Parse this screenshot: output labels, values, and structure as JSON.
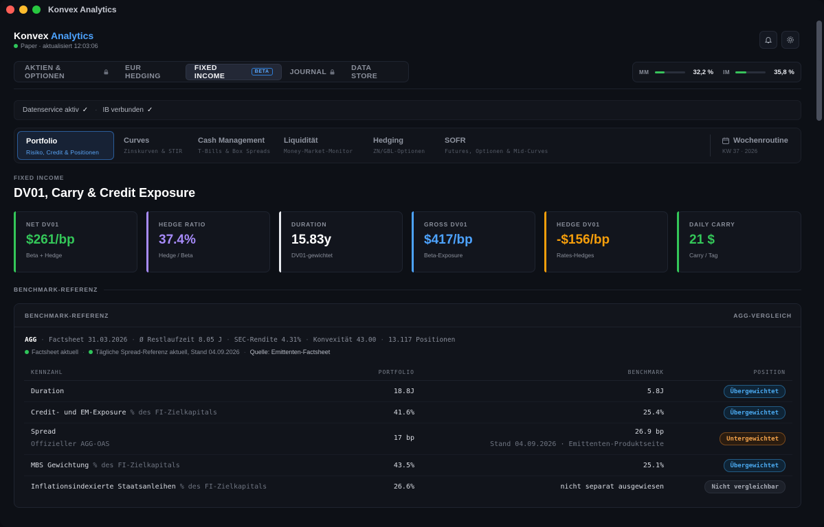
{
  "window": {
    "title": "Konvex Analytics"
  },
  "brand": {
    "name": "Konvex",
    "accent": "Analytics",
    "status_mode": "Paper",
    "status_updated": "· aktualisiert 12:03:06"
  },
  "main_tabs": [
    {
      "label": "AKTIEN & OPTIONEN",
      "locked": true
    },
    {
      "label": "EUR HEDGING",
      "locked": false
    },
    {
      "label": "FIXED INCOME",
      "badge": "BETA",
      "active": true
    },
    {
      "label": "JOURNAL",
      "locked": true
    },
    {
      "label": "DATA STORE",
      "locked": false
    }
  ],
  "meters": [
    {
      "label": "MM",
      "value": "32,2 %",
      "fraction": 0.322
    },
    {
      "label": "IM",
      "value": "35,8 %",
      "fraction": 0.358
    }
  ],
  "status": [
    {
      "label": "Datenservice aktiv"
    },
    {
      "label": "IB verbunden"
    }
  ],
  "sub_nav": [
    {
      "title": "Portfolio",
      "subtitle": "Risiko, Credit & Positionen",
      "active": true
    },
    {
      "title": "Curves",
      "subtitle": "Zinskurven & STIR"
    },
    {
      "title": "Cash Management",
      "subtitle": "T-Bills & Box Spreads"
    },
    {
      "title": "Liquidität",
      "subtitle": "Money-Market-Monitor"
    },
    {
      "title": "Hedging",
      "subtitle": "ZN/GBL-Optionen"
    },
    {
      "title": "SOFR",
      "subtitle": "Futures, Optionen & Mid-Curves"
    }
  ],
  "weekly": {
    "title": "Wochenroutine",
    "subtitle": "KW 37 · 2026"
  },
  "page": {
    "eyebrow": "FIXED INCOME",
    "title": "DV01, Carry & Credit Exposure"
  },
  "kpis": [
    {
      "label": "NET DV01",
      "value": "$261/bp",
      "sub": "Beta + Hedge",
      "color": "#34c759"
    },
    {
      "label": "HEDGE RATIO",
      "value": "37.4%",
      "sub": "Hedge / Beta",
      "color": "#a78bfa"
    },
    {
      "label": "DURATION",
      "value": "15.83y",
      "sub": "DV01-gewichtet",
      "color": "#ffffff"
    },
    {
      "label": "GROSS DV01",
      "value": "$417/bp",
      "sub": "Beta-Exposure",
      "color": "#4da3ff"
    },
    {
      "label": "HEDGE DV01",
      "value": "-$156/bp",
      "sub": "Rates-Hedges",
      "color": "#f59e0b"
    },
    {
      "label": "DAILY CARRY",
      "value": "21 $",
      "sub": "Carry / Tag",
      "color": "#34c759"
    }
  ],
  "benchmark": {
    "section_label": "BENCHMARK-REFERENZ",
    "panel_title": "BENCHMARK-REFERENZ",
    "panel_right": "AGG-VERGLEICH",
    "ticker": "AGG",
    "facts": [
      "Factsheet 31.03.2026",
      "Ø Restlaufzeit 8.05 J",
      "SEC-Rendite 4.31%",
      "Konvexität 43.00",
      "13.117 Positionen"
    ],
    "status_1": "Factsheet aktuell",
    "status_2": "Tägliche Spread-Referenz aktuell, Stand 04.09.2026",
    "source": "Quelle: Emittenten-Factsheet",
    "columns": [
      "KENNZAHL",
      "PORTFOLIO",
      "BENCHMARK",
      "POSITION"
    ],
    "rows": [
      {
        "name": "Duration",
        "note": "",
        "sub": "",
        "portfolio": "18.8J",
        "benchmark": "5.8J",
        "bench_sub": "",
        "position": "Übergewichtet",
        "kind": "blue"
      },
      {
        "name": "Credit- und EM-Exposure",
        "note": "% des FI-Zielkapitals",
        "sub": "",
        "portfolio": "41.6%",
        "benchmark": "25.4%",
        "bench_sub": "",
        "position": "Übergewichtet",
        "kind": "blue"
      },
      {
        "name": "Spread",
        "note": "",
        "sub": "Offizieller AGG-OAS",
        "portfolio": "17 bp",
        "benchmark": "26.9 bp",
        "bench_sub": "Stand 04.09.2026 · Emittenten-Produktseite",
        "position": "Untergewichtet",
        "kind": "orange"
      },
      {
        "name": "MBS Gewichtung",
        "note": "% des FI-Zielkapitals",
        "sub": "",
        "portfolio": "43.5%",
        "benchmark": "25.1%",
        "bench_sub": "",
        "position": "Übergewichtet",
        "kind": "blue"
      },
      {
        "name": "Inflationsindexierte Staatsanleihen",
        "note": "% des FI-Zielkapitals",
        "sub": "",
        "portfolio": "26.6%",
        "benchmark": "nicht separat ausgewiesen",
        "bench_sub": "",
        "position": "Nicht vergleichbar",
        "kind": "grey"
      }
    ]
  }
}
